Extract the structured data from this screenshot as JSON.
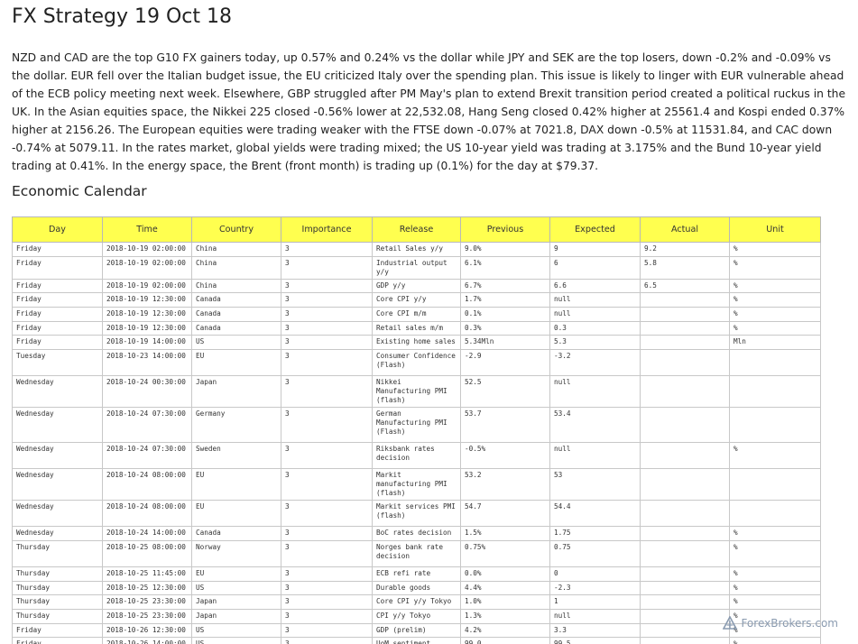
{
  "title": "FX Strategy 19 Oct 18",
  "summary": "NZD and CAD are the top G10 FX gainers today, up 0.57% and 0.24% vs the dollar while JPY and SEK are the top losers, down -0.2% and -0.09% vs the dollar. EUR fell over the Italian budget issue, the EU criticized Italy over the spending plan. This issue is likely to linger with EUR vulnerable ahead of the ECB policy meeting next week. Elsewhere, GBP struggled after PM May's plan to extend Brexit transition period created a political ruckus in the UK. In the Asian equities space, the Nikkei 225 closed -0.56% lower at 22,532.08, Hang Seng closed 0.42% higher at 25561.4 and Kospi ended 0.37% higher at 2156.26. The European equities were trading weaker with the FTSE down -0.07% at 7021.8, DAX down -0.5% at 11531.84, and CAC down -0.74% at 5079.11. In the rates market, global yields were trading mixed; the US 10-year yield was trading at 3.175% and the Bund 10-year yield trading at 0.41%. In the energy space, the Brent (front month) is trading up (0.1%) for the day at $79.37.",
  "calendar": {
    "heading": "Economic Calendar",
    "header_color": "#ffff4f",
    "columns": [
      "Day",
      "Time",
      "Country",
      "Importance",
      "Release",
      "Previous",
      "Expected",
      "Actual",
      "Unit"
    ],
    "rows": [
      [
        "Friday",
        "2018-10-19 02:00:00",
        "China",
        "3",
        "Retail Sales y/y",
        "9.0%",
        "9",
        "9.2",
        "%"
      ],
      [
        "Friday",
        "2018-10-19 02:00:00",
        "China",
        "3",
        "Industrial output y/y",
        "6.1%",
        "6",
        "5.8",
        "%"
      ],
      [
        "Friday",
        "2018-10-19 02:00:00",
        "China",
        "3",
        "GDP y/y",
        "6.7%",
        "6.6",
        "6.5",
        "%"
      ],
      [
        "Friday",
        "2018-10-19 12:30:00",
        "Canada",
        "3",
        "Core CPI y/y",
        "1.7%",
        "null",
        "",
        "%"
      ],
      [
        "Friday",
        "2018-10-19 12:30:00",
        "Canada",
        "3",
        "Core CPI m/m",
        "0.1%",
        "null",
        "",
        "%"
      ],
      [
        "Friday",
        "2018-10-19 12:30:00",
        "Canada",
        "3",
        "Retail sales m/m",
        "0.3%",
        "0.3",
        "",
        "%"
      ],
      [
        "Friday",
        "2018-10-19 14:00:00",
        "US",
        "3",
        "Existing home sales",
        "5.34Mln",
        "5.3",
        "",
        "Mln"
      ],
      [
        "Tuesday",
        "2018-10-23 14:00:00",
        "EU",
        "3",
        "Consumer Confidence (Flash)",
        "-2.9",
        "-3.2",
        "",
        ""
      ],
      [
        "Wednesday",
        "2018-10-24 00:30:00",
        "Japan",
        "3",
        "Nikkei Manufacturing PMI (flash)",
        "52.5",
        "null",
        "",
        ""
      ],
      [
        "Wednesday",
        "2018-10-24 07:30:00",
        "Germany",
        "3",
        "German Manufacturing PMI (Flash)",
        "53.7",
        "53.4",
        "",
        ""
      ],
      [
        "Wednesday",
        "2018-10-24 07:30:00",
        "Sweden",
        "3",
        "Riksbank rates decision",
        "-0.5%",
        "null",
        "",
        "%"
      ],
      [
        "Wednesday",
        "2018-10-24 08:00:00",
        "EU",
        "3",
        "Markit manufacturing PMI (flash)",
        "53.2",
        "53",
        "",
        ""
      ],
      [
        "Wednesday",
        "2018-10-24 08:00:00",
        "EU",
        "3",
        "Markit services PMI (flash)",
        "54.7",
        "54.4",
        "",
        ""
      ],
      [
        "Wednesday",
        "2018-10-24 14:00:00",
        "Canada",
        "3",
        "BoC rates decision",
        "1.5%",
        "1.75",
        "",
        "%"
      ],
      [
        "Thursday",
        "2018-10-25 08:00:00",
        "Norway",
        "3",
        "Norges bank rate decision",
        "0.75%",
        "0.75",
        "",
        "%"
      ],
      [
        "Thursday",
        "2018-10-25 11:45:00",
        "EU",
        "3",
        "ECB refi rate",
        "0.0%",
        "0",
        "",
        "%"
      ],
      [
        "Thursday",
        "2018-10-25 12:30:00",
        "US",
        "3",
        "Durable goods",
        "4.4%",
        "-2.3",
        "",
        "%"
      ],
      [
        "Thursday",
        "2018-10-25 23:30:00",
        "Japan",
        "3",
        "Core CPI y/y Tokyo",
        "1.0%",
        "1",
        "",
        "%"
      ],
      [
        "Thursday",
        "2018-10-25 23:30:00",
        "Japan",
        "3",
        "CPI y/y Tokyo",
        "1.3%",
        "null",
        "",
        "%"
      ],
      [
        "Friday",
        "2018-10-26 12:30:00",
        "US",
        "3",
        "GDP (prelim)",
        "4.2%",
        "3.3",
        "",
        "%"
      ],
      [
        "Friday",
        "2018-10-26 14:00:00",
        "US",
        "3",
        "UoM sentiment (final)",
        "99.0",
        "99.5",
        "",
        "%"
      ]
    ]
  },
  "watermark": {
    "text": "ForexBrokers.com",
    "icon": "forexbrokers-logo-icon",
    "color": "#8a9bb0"
  }
}
